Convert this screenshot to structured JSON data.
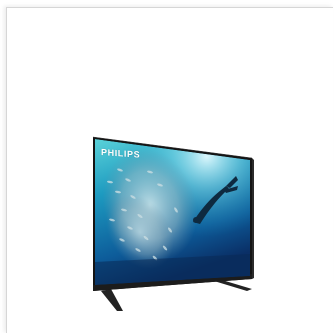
{
  "product": {
    "brand": "PHILIPS",
    "screen_icon": "tv-icon"
  },
  "colors": {
    "background": "#ffffff",
    "screen_top": "#2aa9c4",
    "screen_bottom": "#0c3f78",
    "bezel": "#141414",
    "stand": "#2a2a2a"
  }
}
